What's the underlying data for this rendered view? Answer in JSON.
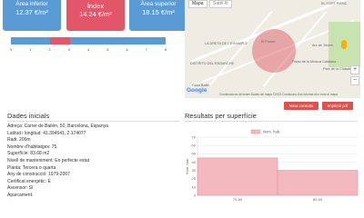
{
  "boxes": {
    "inferior": {
      "title": "Àrea inferior",
      "title_visible": "inferior",
      "value": "12.37 €/m²"
    },
    "index": {
      "title": "Índex",
      "value": "14.24 €/m²"
    },
    "superior": {
      "title": "Àrea superior",
      "value": "18.15 €/m²"
    }
  },
  "scale": {
    "ticks": [
      "0",
      "1",
      "2",
      "3",
      "4",
      "5",
      "6",
      "7",
      "8"
    ]
  },
  "map": {
    "tab_map": "Mapa",
    "tab_satellite": "Satèl·lit",
    "labels": {
      "exaiple": "LA DRETA DE L'EIXAMPLE",
      "enghanche": "DISTRITO DEL ENSANCHE",
      "casa_batllo": "Casa Batlló",
      "forum": "El Fòrum",
      "palau": "Palau de la Música Catalana",
      "triomf": "Arc de Triomf",
      "fort_pienc": "EL FORT PIENC",
      "ciutadella": "Parc de la Ciutadella",
      "google": "Google",
      "attrib": "Combinacions de tecles   Dades del mapa ©2022   Condicions d'ús   Informa d'un error al mapa"
    },
    "zoom_in": "+",
    "zoom_out": "−"
  },
  "buttons": {
    "new_query": "Nova consulta",
    "print_pdf": "Imprimir pdf"
  },
  "sections": {
    "initial_data": "Dades inicials",
    "results": "Resultats per superfície"
  },
  "data_items": [
    "Adreça: Carrer de Bailèn, 50, Barcelona, Espanya",
    "Latitud i longitud: 41.394541, 2.174077",
    "Radi: 200m",
    "Nombre d'habitatges: 75",
    "Superfície: 83.68 m2",
    "Nivell de manteniment: En perfecte estat",
    "Planta: Tercera o quarta",
    "Any de construcció: 1979-2007",
    "Certificat energètic: E",
    "Ascensor: Sí",
    "Aparcament:"
  ],
  "chart_data": {
    "type": "bar",
    "categories": [
      "70-80",
      "80-90"
    ],
    "series": [
      {
        "name": "Nom. hab.",
        "values": [
          45,
          30
        ]
      }
    ],
    "ylabel": "Nom. hab.",
    "ylim": [
      0,
      70
    ],
    "yticks": [
      "0",
      "10",
      "20",
      "30",
      "40",
      "50",
      "60",
      "70"
    ],
    "grid": true,
    "legend": "top",
    "color": "#f4b8bf",
    "stroke": "#e8909b"
  }
}
